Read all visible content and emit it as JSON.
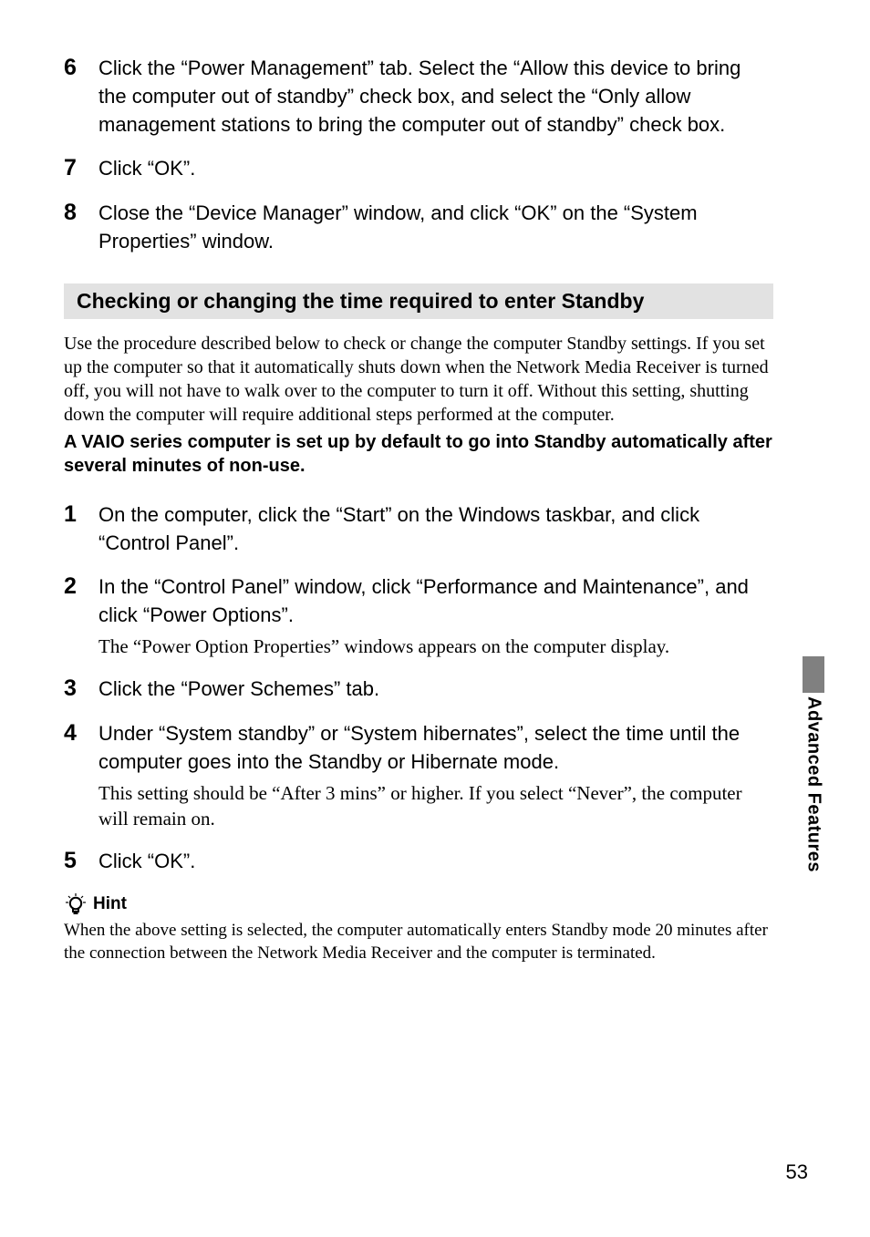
{
  "stepsUpper": [
    {
      "num": "6",
      "main": "Click the “Power Management” tab. Select the “Allow this device to bring the computer out of standby” check box, and select the “Only allow management stations to bring the computer out of standby” check box."
    },
    {
      "num": "7",
      "main": "Click “OK”."
    },
    {
      "num": "8",
      "main": "Close the “Device Manager” window, and click “OK” on the “System Properties” window."
    }
  ],
  "section": {
    "heading": "Checking or changing the time required to enter Standby",
    "intro": "Use the procedure described below to check or change the computer Standby settings. If you set up the computer so that it automatically shuts down when the Network Media Receiver is turned off, you will not have to walk over to the computer to turn it off. Without this setting, shutting down the computer will require additional steps performed at the computer.",
    "introBold": "A VAIO series computer is set up by default to go into Standby automatically after several minutes of non-use."
  },
  "stepsLower": [
    {
      "num": "1",
      "main": "On the computer, click the “Start” on the Windows taskbar, and click “Control Panel”."
    },
    {
      "num": "2",
      "main": "In the “Control Panel” window, click “Performance and Maintenance”, and click “Power Options”.",
      "sub": "The “Power Option Properties” windows appears on the computer display."
    },
    {
      "num": "3",
      "main": "Click the “Power Schemes” tab."
    },
    {
      "num": "4",
      "main": "Under “System standby” or “System hibernates”, select the time until the computer goes into the Standby or Hibernate mode.",
      "sub": "This setting should be “After 3 mins” or higher. If you select “Never”, the computer will remain on."
    },
    {
      "num": "5",
      "main": "Click “OK”."
    }
  ],
  "hint": {
    "label": "Hint",
    "text": "When the above setting is selected, the computer automatically enters Standby mode 20 minutes after the connection between the Network Media Receiver and the computer is terminated."
  },
  "sideTab": "Advanced Features",
  "pageNumber": "53"
}
